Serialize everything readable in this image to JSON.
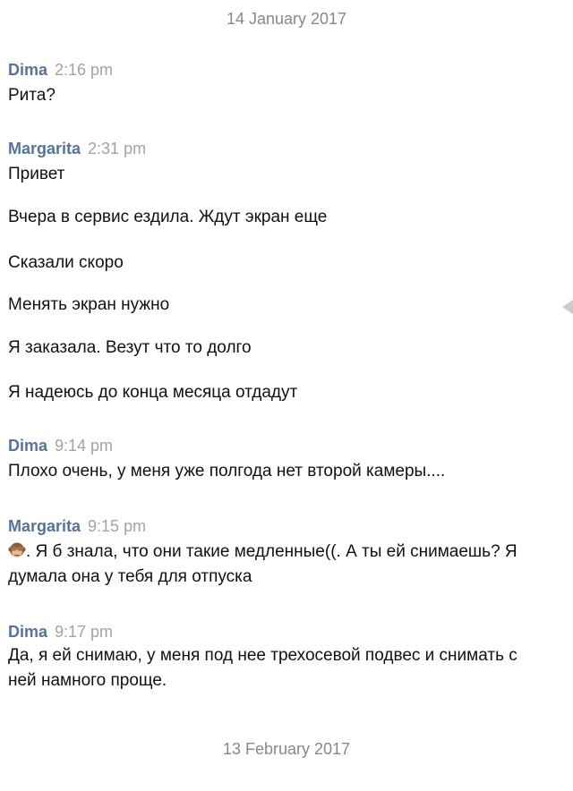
{
  "dates": [
    "14 January 2017",
    "13 February 2017"
  ],
  "messages": [
    {
      "sender": "Dima",
      "time": "2:16 pm",
      "lines": [
        "Рита?"
      ]
    },
    {
      "sender": "Margarita",
      "time": "2:31 pm",
      "lines": [
        "Привет",
        "Вчера в сервис ездила. Ждут экран еще",
        "Сказали скоро",
        "Менять экран нужно",
        "Я заказала. Везут что то долго",
        "Я надеюсь до конца месяца отдадут"
      ]
    },
    {
      "sender": "Dima",
      "time": "9:14 pm",
      "lines": [
        "Плохо очень, у меня уже полгода нет второй камеры...."
      ]
    },
    {
      "sender": "Margarita",
      "time": "9:15 pm",
      "emoji": "see-no-evil-monkey-icon",
      "lines": [
        ". Я б знала, что они такие медленные((. А ты ей снимаешь? Я думала она у тебя для отпуска"
      ]
    },
    {
      "sender": "Dima",
      "time": "9:17 pm",
      "lines": [
        "Да, я ей снимаю, у меня под нее трехосевой подвес и снимать с ней намного проще."
      ]
    }
  ],
  "colors": {
    "sender": "#55739b",
    "time": "#a3a3a3",
    "date": "#888888"
  },
  "icons": {
    "scroll_indicator": "triangle-left-icon"
  }
}
